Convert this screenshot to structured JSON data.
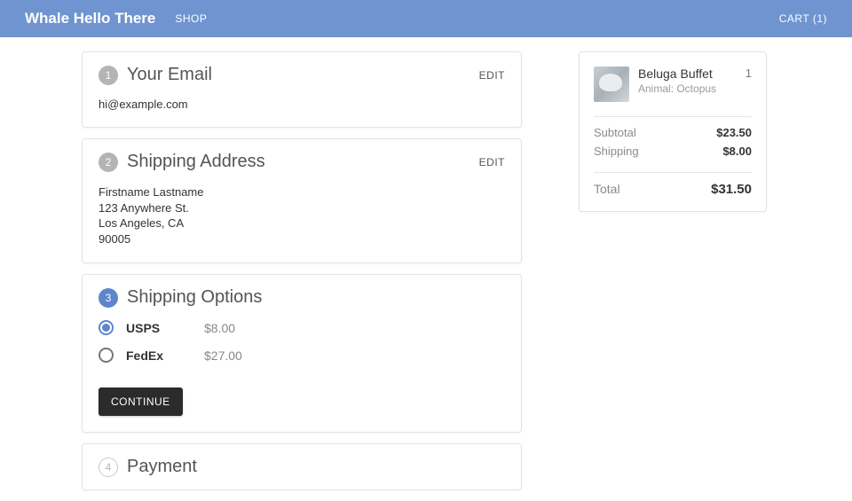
{
  "header": {
    "brand": "Whale Hello There",
    "shop": "SHOP",
    "cart": "CART (1)"
  },
  "steps": {
    "email": {
      "num": "1",
      "title": "Your Email",
      "edit": "EDIT",
      "value": "hi@example.com"
    },
    "address": {
      "num": "2",
      "title": "Shipping Address",
      "edit": "EDIT",
      "name": "Firstname Lastname",
      "street": "123 Anywhere St.",
      "city": "Los Angeles, CA",
      "zip": "90005"
    },
    "shipping": {
      "num": "3",
      "title": "Shipping Options",
      "options": [
        {
          "name": "USPS",
          "price": "$8.00",
          "selected": true
        },
        {
          "name": "FedEx",
          "price": "$27.00",
          "selected": false
        }
      ],
      "continue": "CONTINUE"
    },
    "payment": {
      "num": "4",
      "title": "Payment"
    }
  },
  "cart": {
    "product": {
      "name": "Beluga Buffet",
      "subtitle": "Animal: Octopus",
      "qty": "1"
    },
    "subtotal_label": "Subtotal",
    "subtotal": "$23.50",
    "shipping_label": "Shipping",
    "shipping": "$8.00",
    "total_label": "Total",
    "total": "$31.50"
  }
}
